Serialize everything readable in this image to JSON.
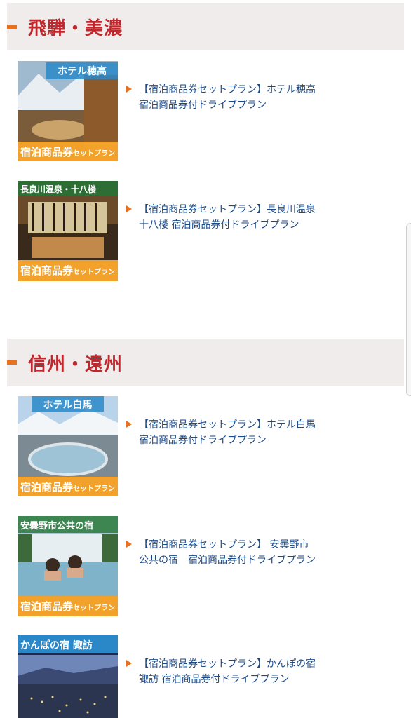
{
  "sections": [
    {
      "title": "飛騨・美濃",
      "items": [
        {
          "thumb_title": "ホテル穂高",
          "thumb_badge": "宿泊商品券",
          "thumb_badge_small": "セットプラン",
          "text": "【宿泊商品券セットプラン】ホテル穂高 宿泊商品券付ドライブプラン"
        },
        {
          "thumb_title": "長良川温泉・十八楼",
          "thumb_badge": "宿泊商品券",
          "thumb_badge_small": "セットプラン",
          "text": "【宿泊商品券セットプラン】長良川温泉 十八楼 宿泊商品券付ドライブプラン"
        }
      ]
    },
    {
      "title": "信州・遠州",
      "items": [
        {
          "thumb_title": "ホテル白馬",
          "thumb_badge": "宿泊商品券",
          "thumb_badge_small": "セットプラン",
          "text": "【宿泊商品券セットプラン】ホテル白馬　宿泊商品券付ドライブプラン"
        },
        {
          "thumb_title": "安曇野市公共の宿",
          "thumb_badge": "宿泊商品券",
          "thumb_badge_small": "セットプラン",
          "text": "【宿泊商品券セットプラン】 安曇野市公共の宿　宿泊商品券付ドライブプラン"
        },
        {
          "thumb_title": "かんぽの宿 諏訪",
          "thumb_badge": "",
          "thumb_badge_small": "",
          "text": "【宿泊商品券セットプラン】かんぽの宿諏訪 宿泊商品券付ドライブプラン"
        }
      ]
    }
  ],
  "colors": {
    "accent": "#e8711f",
    "section_title": "#c0282d",
    "link": "#1a4a8a",
    "header_bg": "#efeceb"
  }
}
